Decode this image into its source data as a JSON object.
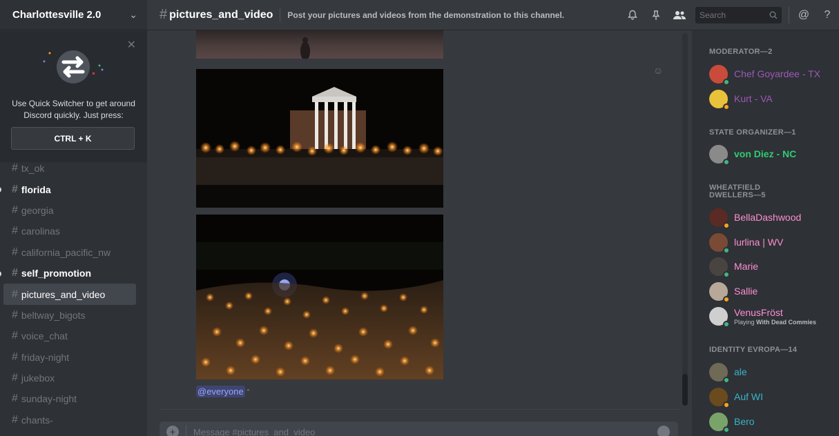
{
  "server": {
    "name": "Charlottesville 2.0"
  },
  "quick_switcher": {
    "text": "Use Quick Switcher to get around Discord quickly. Just press:",
    "shortcut": "CTRL + K"
  },
  "channels": [
    {
      "name": "tx_ok",
      "state": "normal"
    },
    {
      "name": "florida",
      "state": "unread"
    },
    {
      "name": "georgia",
      "state": "normal"
    },
    {
      "name": "carolinas",
      "state": "normal"
    },
    {
      "name": "california_pacific_nw",
      "state": "normal"
    },
    {
      "name": "self_promotion",
      "state": "unread"
    },
    {
      "name": "pictures_and_video",
      "state": "active"
    },
    {
      "name": "beltway_bigots",
      "state": "normal"
    },
    {
      "name": "voice_chat",
      "state": "normal"
    },
    {
      "name": "friday-night",
      "state": "normal"
    },
    {
      "name": "jukebox",
      "state": "normal"
    },
    {
      "name": "sunday-night",
      "state": "normal"
    },
    {
      "name": "chants-",
      "state": "normal"
    }
  ],
  "topbar": {
    "channel": "pictures_and_video",
    "topic": "Post your pictures and videos from the demonstration to this channel.",
    "search_placeholder": "Search"
  },
  "chat": {
    "mention": "@everyone",
    "composer_placeholder": "Message #pictures_and_video"
  },
  "members": {
    "groups": [
      {
        "label": "MODERATOR—2"
      },
      {
        "label": "STATE ORGANIZER—1"
      },
      {
        "label": "WHEATFIELD DWELLERS—5"
      },
      {
        "label": "IDENTITY EVROPA—14"
      }
    ],
    "list": [
      {
        "name": "Chef Goyardee - TX",
        "color": "#9b59b6",
        "status": "online",
        "avatar": "#c94b3b"
      },
      {
        "name": "Kurt - VA",
        "color": "#9b59b6",
        "status": "idle",
        "avatar": "#e8c23a"
      },
      {
        "name": "von Diez - NC",
        "color": "#2ecc71",
        "status": "online",
        "avatar": "#8a8a8a"
      },
      {
        "name": "BellaDashwood",
        "color": "#ff8fd0",
        "status": "idle",
        "avatar": "#5a2a24"
      },
      {
        "name": "lurlina | WV",
        "color": "#ff8fd0",
        "status": "online",
        "avatar": "#7a4a34"
      },
      {
        "name": "Marie",
        "color": "#ff8fd0",
        "status": "online",
        "avatar": "#4a4440"
      },
      {
        "name": "Sallie",
        "color": "#ff8fd0",
        "status": "idle",
        "avatar": "#b8a89a"
      },
      {
        "name": "VenusFröst",
        "color": "#ff8fd0",
        "status": "online",
        "avatar": "#cfcfcf",
        "game_prefix": "Playing",
        "game": "With Dead Commies"
      },
      {
        "name": "ale",
        "color": "#3ab4c8",
        "status": "online",
        "avatar": "#6e6a55"
      },
      {
        "name": "Auf WI",
        "color": "#3ab4c8",
        "status": "idle",
        "avatar": "#6b4a1e"
      },
      {
        "name": "Bero",
        "color": "#3ab4c8",
        "status": "online",
        "avatar": "#7aa36a"
      }
    ]
  }
}
